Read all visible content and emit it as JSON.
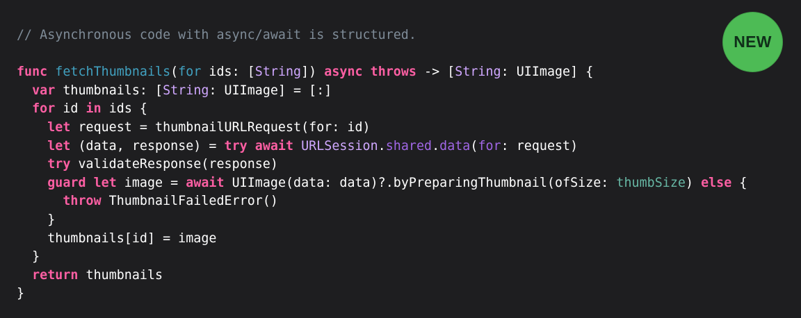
{
  "badge": {
    "label": "NEW",
    "color": "#4dbb55"
  },
  "theme": {
    "background": "#1e1e20",
    "plain": "#ffffff",
    "keyword": "#fc5fa3",
    "function_name": "#41a1c0",
    "type": "#d0a8ff",
    "project_symbol": "#a167e6",
    "variable": "#67b7a4",
    "comment": "#7f8c98"
  },
  "code": {
    "lines": [
      [
        {
          "t": "// Asynchronous code with async/await is structured.",
          "c": "comment"
        }
      ],
      [],
      [
        {
          "t": "func",
          "c": "keyword"
        },
        {
          "t": " ",
          "c": "plain"
        },
        {
          "t": "fetchThumbnails",
          "c": "funcname"
        },
        {
          "t": "(",
          "c": "plain"
        },
        {
          "t": "for",
          "c": "funcname"
        },
        {
          "t": " ids: [",
          "c": "plain"
        },
        {
          "t": "String",
          "c": "type"
        },
        {
          "t": "]) ",
          "c": "plain"
        },
        {
          "t": "async",
          "c": "keyword"
        },
        {
          "t": " ",
          "c": "plain"
        },
        {
          "t": "throws",
          "c": "keyword"
        },
        {
          "t": " -> [",
          "c": "plain"
        },
        {
          "t": "String",
          "c": "type"
        },
        {
          "t": ": UIImage] {",
          "c": "plain"
        }
      ],
      [
        {
          "t": "  ",
          "c": "plain"
        },
        {
          "t": "var",
          "c": "keyword"
        },
        {
          "t": " thumbnails: [",
          "c": "plain"
        },
        {
          "t": "String",
          "c": "type"
        },
        {
          "t": ": UIImage] = [:]",
          "c": "plain"
        }
      ],
      [
        {
          "t": "  ",
          "c": "plain"
        },
        {
          "t": "for",
          "c": "keyword"
        },
        {
          "t": " id ",
          "c": "plain"
        },
        {
          "t": "in",
          "c": "keyword"
        },
        {
          "t": " ids {",
          "c": "plain"
        }
      ],
      [
        {
          "t": "    ",
          "c": "plain"
        },
        {
          "t": "let",
          "c": "keyword"
        },
        {
          "t": " request = thumbnailURLRequest(for: id)",
          "c": "plain"
        }
      ],
      [
        {
          "t": "    ",
          "c": "plain"
        },
        {
          "t": "let",
          "c": "keyword"
        },
        {
          "t": " (data, response) = ",
          "c": "plain"
        },
        {
          "t": "try",
          "c": "keyword"
        },
        {
          "t": " ",
          "c": "plain"
        },
        {
          "t": "await",
          "c": "keyword"
        },
        {
          "t": " ",
          "c": "plain"
        },
        {
          "t": "URLSession",
          "c": "type"
        },
        {
          "t": ".",
          "c": "plain"
        },
        {
          "t": "shared",
          "c": "project"
        },
        {
          "t": ".",
          "c": "plain"
        },
        {
          "t": "data",
          "c": "project"
        },
        {
          "t": "(",
          "c": "plain"
        },
        {
          "t": "for",
          "c": "project"
        },
        {
          "t": ": request)",
          "c": "plain"
        }
      ],
      [
        {
          "t": "    ",
          "c": "plain"
        },
        {
          "t": "try",
          "c": "keyword"
        },
        {
          "t": " validateResponse(response)",
          "c": "plain"
        }
      ],
      [
        {
          "t": "    ",
          "c": "plain"
        },
        {
          "t": "guard",
          "c": "keyword"
        },
        {
          "t": " ",
          "c": "plain"
        },
        {
          "t": "let",
          "c": "keyword"
        },
        {
          "t": " image = ",
          "c": "plain"
        },
        {
          "t": "await",
          "c": "keyword"
        },
        {
          "t": " UIImage(data: data)?.byPreparingThumbnail(ofSize: ",
          "c": "plain"
        },
        {
          "t": "thumbSize",
          "c": "var"
        },
        {
          "t": ") ",
          "c": "plain"
        },
        {
          "t": "else",
          "c": "keyword"
        },
        {
          "t": " {",
          "c": "plain"
        }
      ],
      [
        {
          "t": "      ",
          "c": "plain"
        },
        {
          "t": "throw",
          "c": "keyword"
        },
        {
          "t": " ThumbnailFailedError()",
          "c": "plain"
        }
      ],
      [
        {
          "t": "    }",
          "c": "plain"
        }
      ],
      [
        {
          "t": "    thumbnails[id] = image",
          "c": "plain"
        }
      ],
      [
        {
          "t": "  }",
          "c": "plain"
        }
      ],
      [
        {
          "t": "  ",
          "c": "plain"
        },
        {
          "t": "return",
          "c": "keyword"
        },
        {
          "t": " thumbnails",
          "c": "plain"
        }
      ],
      [
        {
          "t": "}",
          "c": "plain"
        }
      ]
    ]
  }
}
